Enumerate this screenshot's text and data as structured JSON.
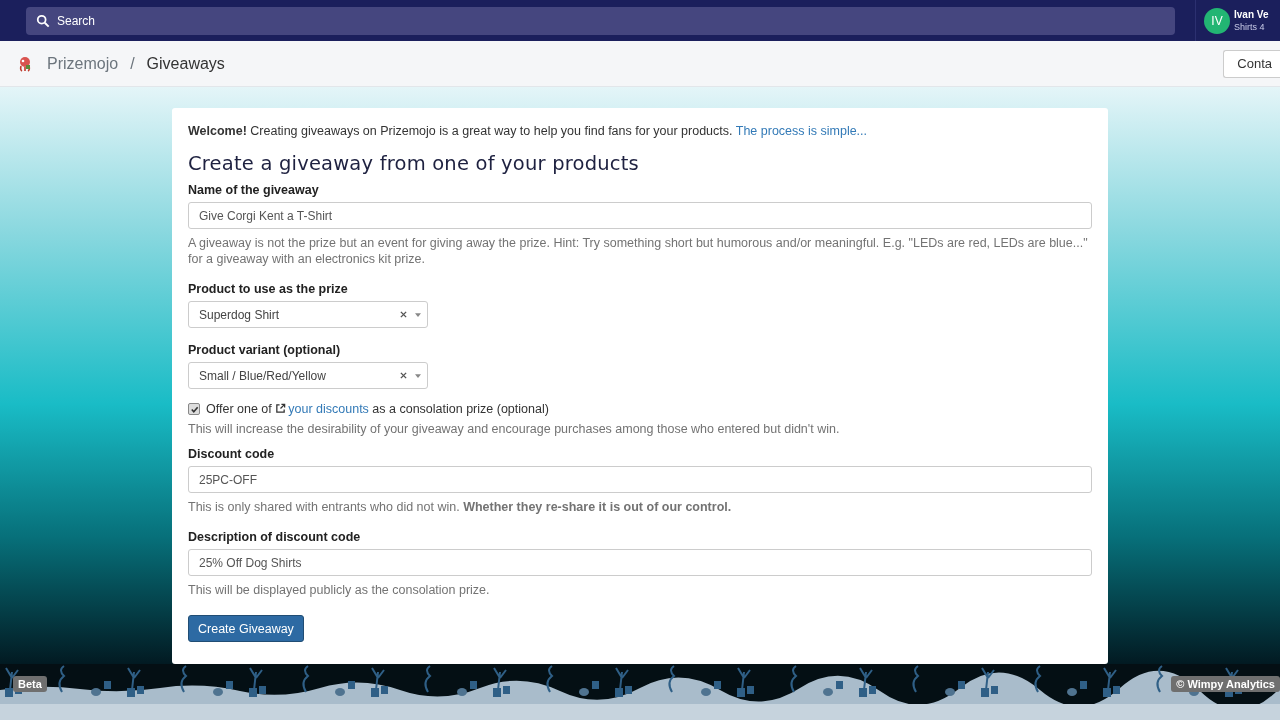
{
  "top_bar": {
    "search": {
      "placeholder": "Search"
    },
    "user": {
      "initials": "IV",
      "name": "Ivan Ve",
      "store": "Shirts 4"
    }
  },
  "breadcrumb": {
    "items": [
      "Prizemojo",
      "Giveaways"
    ],
    "separator": "/",
    "button": "Conta"
  },
  "intro": {
    "text": "**Welcome!** Creating giveaways on Prizemojo is a great way to help you find fans for your products.",
    "link": "The process is simple..."
  },
  "heading": "Create a giveaway from one of your products",
  "fields": [
    {
      "kind": "text",
      "label": "Name of the giveaway",
      "value": "Give Corgi Kent a T-Shirt",
      "hint": "A giveaway is not the prize but an event for giving away the prize. Hint: Try something short but humorous and/or meaningful. E.g. \"LEDs are red, LEDs are blue...\" for a giveaway with an electronics kit prize."
    },
    {
      "kind": "select",
      "label": "Product to use as the prize",
      "value": "Superdog Shirt"
    },
    {
      "kind": "select",
      "label": "Product variant (optional)",
      "value": "Small / Blue/Red/Yellow"
    },
    {
      "kind": "checkbox",
      "checked": true,
      "before": "Offer one of",
      "link": "your discounts",
      "after": "as a consolation prize (optional)",
      "hint": "This will increase the desirability of your giveaway and encourage purchases among those who entered but didn't win."
    },
    {
      "kind": "text",
      "label": "Discount code",
      "value": "25PC-OFF",
      "hint": "This is only shared with entrants who did not win. **Whether they re-share it is out of our control.**"
    },
    {
      "kind": "text",
      "label": "Description of discount code",
      "value": "25% Off Dog Shirts",
      "hint": "This will be displayed publicly as the consolation prize."
    }
  ],
  "submit": "Create Giveaway",
  "footer": {
    "left_badge": "Beta",
    "right_badge": "© Wimpy Analytics"
  }
}
